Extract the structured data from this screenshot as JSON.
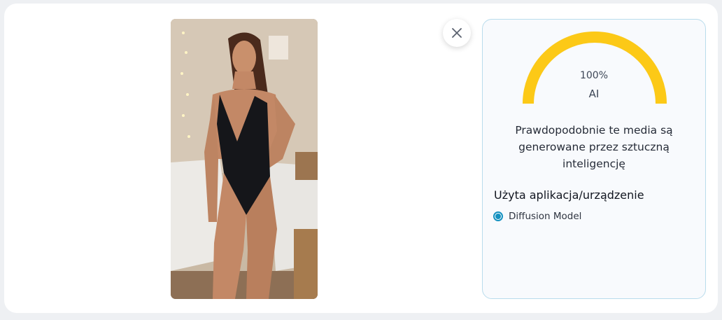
{
  "result": {
    "percent_text": "100%",
    "label": "AI",
    "score_fraction": 1.0,
    "gauge_color": "#fcc917",
    "verdict": "Prawdopodobnie te media są generowane przez sztuczną inteligencję"
  },
  "source": {
    "heading": "Użyta aplikacja/urządzenie",
    "options": [
      {
        "label": "Diffusion Model",
        "selected": true
      }
    ]
  },
  "controls": {
    "close_icon": "close-icon"
  },
  "colors": {
    "accent": "#1591c0",
    "panel_border": "#b9dcec"
  }
}
